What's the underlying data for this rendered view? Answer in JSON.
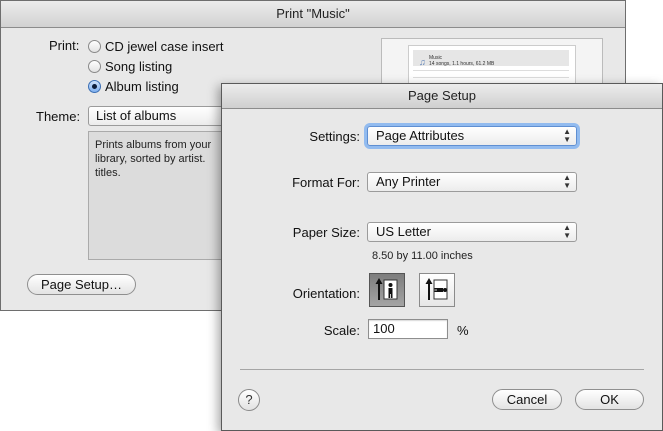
{
  "print_window": {
    "title": "Print \"Music\"",
    "print_label": "Print:",
    "options": [
      {
        "label": "CD jewel case insert",
        "selected": false
      },
      {
        "label": "Song listing",
        "selected": false
      },
      {
        "label": "Album listing",
        "selected": true
      }
    ],
    "theme_label": "Theme:",
    "theme_value": "List of albums",
    "description": "Prints albums from your library, sorted by artist. titles.",
    "page_setup_button": "Page Setup…",
    "preview": {
      "title": "Music",
      "subtitle": "14 songs, 1.1 hours, 61.2 MB"
    }
  },
  "page_setup": {
    "title": "Page Setup",
    "settings_label": "Settings:",
    "settings_value": "Page Attributes",
    "format_for_label": "Format For:",
    "format_for_value": "Any Printer",
    "paper_size_label": "Paper Size:",
    "paper_size_value": "US Letter",
    "paper_dimensions": "8.50 by 11.00 inches",
    "orientation_label": "Orientation:",
    "orientation_selected": "portrait",
    "scale_label": "Scale:",
    "scale_value": "100",
    "scale_unit": "%",
    "help_label": "?",
    "cancel_button": "Cancel",
    "ok_button": "OK"
  },
  "colors": {
    "window_bg": "#e8e8e8",
    "focus_ring": "#92bbef",
    "radio_selected": "#7fb0ef"
  }
}
